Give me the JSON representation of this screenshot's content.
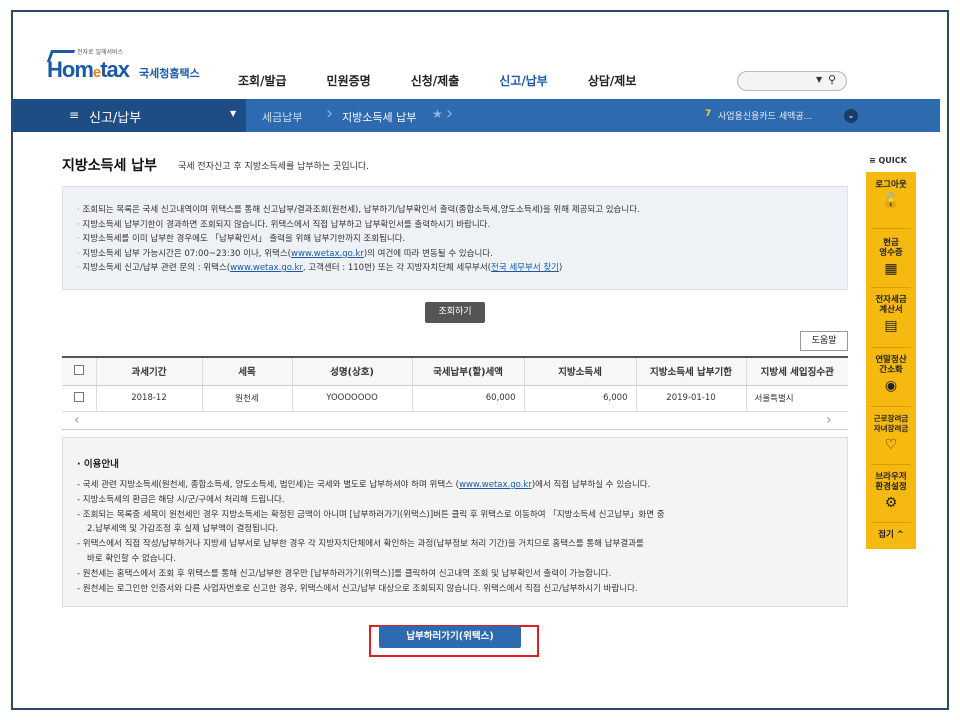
{
  "header": {
    "logo_sub": "전자로 일해서비스",
    "logo_home": "Hom",
    "logo_e": "e",
    "logo_tax": "tax",
    "logo_kr": "국세청홈택스",
    "gnb": [
      "조회/발급",
      "민원증명",
      "신청/제출",
      "신고/납부",
      "상담/제보"
    ],
    "search_arrow": "▼",
    "search_icon": "search-icon"
  },
  "navbar": {
    "menu_icon": "≡",
    "title": "신고/납부",
    "drop": "▼",
    "crumb1": "세금납부",
    "crumb2": "지방소득세 납부",
    "star": "★",
    "rank": "7",
    "rolling_text": "사업용신용카드 세액공...",
    "rolling_btn": "⌄"
  },
  "page": {
    "title": "지방소득세 납부",
    "desc": "국세 전자신고 후 지방소득세를 납부하는 곳입니다."
  },
  "info": {
    "line1": "조회되는 목록은 국세 신고내역이며 위택스를 통해 신고납부/결과조회(원천세), 납부하기/납부확인서 출력(종합소득세,양도소득세)을 위해 제공되고 있습니다.",
    "line2": "지방소득세 납부기한이 경과하면 조회되지 않습니다. 위택스에서 직접 납부하고 납부확인서를 출력하시기 바랍니다.",
    "line3": "지방소득세를 이미 납부한 경우에도 「납부확인서」 출력을 위해 납부기한까지 조회됩니다.",
    "line4a": "지방소득세 납부 가능시간은 07:00~23:30 이나, 위택스(",
    "line4_link": "www.wetax.go.kr",
    "line4b": ")의 여건에 따라 변동될 수 있습니다.",
    "line5a": "지방소득세 신고/납부 관련 문의 : 위택스(",
    "line5_link": "www.wetax.go.kr",
    "line5b": ", 고객센터 : 110번) 또는 각 지방자치단체 세무부서(",
    "line5_link2": "전국 세무부서 찾기",
    "line5c": ")"
  },
  "buttons": {
    "inquiry": "조회하기",
    "help": "도움말",
    "pay": "납부하러가기(위택스)"
  },
  "table": {
    "headers": [
      "과세기간",
      "세목",
      "성명(상호)",
      "국세납부(할)세액",
      "지방소득세",
      "지방소득세 납부기한",
      "지방세 세입징수관"
    ],
    "rows": [
      [
        "2018-12",
        "원천세",
        "YOOOOOOO",
        "60,000",
        "6,000",
        "2019-01-10",
        "서울특별시"
      ]
    ],
    "scroll_left": "‹",
    "scroll_right": "›"
  },
  "guide": {
    "title": "이용안내",
    "line1a": "- 국세 관련 지방소득세(원천세, 종합소득세, 양도소득세, 법인세)는 국세와 별도로 납부하셔야 하며 위택스 (",
    "line1_link": "www.wetax.go.kr",
    "line1b": ")에서 직접 납부하실 수 있습니다.",
    "line2": "- 지방소득세의 환급은 해당 시/군/구에서 처리해 드립니다.",
    "line3": "- 조회되는 목록중 세목이 원천세인 경우 지방소득세는 확정된 금액이 아니며 [납부하러가기(위택스)]버튼 클릭 후 위택스로 이동하여 「지방소득세 신고납부」화면 중",
    "line3c": "2.납부세액 및 가감조정 후 실제 납부액이 결정됩니다.",
    "line4": "- 위택스에서 직접 작성/납부하거나 지방세 납부서로 납부한 경우 각 지방자치단체에서 확인하는 과정(납부정보 처리 기간)을 거치므로 홈택스를 통해 납부결과를",
    "line4c": "바로 확인할 수 없습니다.",
    "line5": "- 원천세는 홈택스에서 조회 후 위택스를 통해 신고/납부한 경우만 [납부하러가기(위택스)]를 클릭하여 신고내역 조회 및 납부확인서 출력이 가능합니다.",
    "line6": "- 원천세는 로그인한 인증서와 다른 사업자번호로 신고한 경우, 위택스에서 신고/납부 대상으로 조회되지 않습니다. 위택스에서 직접 신고/납부하시기 바랍니다."
  },
  "quick": {
    "head": "≡ QUICK",
    "items": [
      {
        "label": "로그아웃",
        "icon": "🔓"
      },
      {
        "label": "현금\n영수증",
        "icon": "▦"
      },
      {
        "label": "전자세금\n계산서",
        "icon": "▤"
      },
      {
        "label": "연말정산\n간소화",
        "icon": "◉"
      },
      {
        "label": "근로장려금\n자녀장려금",
        "icon": "♡"
      },
      {
        "label": "브라우저\n환경설정",
        "icon": "⚙"
      }
    ],
    "fold": "접기 ^"
  },
  "colors": {
    "navbar": "#2d6ab0",
    "navbar_dark": "#1e4d86",
    "quick": "#f5b90f",
    "highlight_outline": "#e02020"
  }
}
